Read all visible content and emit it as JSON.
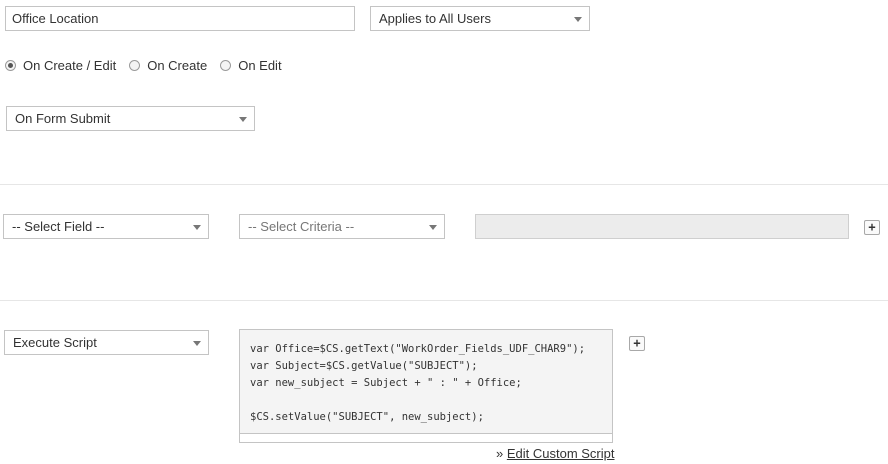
{
  "field_name": {
    "value": "Office Location"
  },
  "applies_to": {
    "selected": "Applies to All Users"
  },
  "trigger_radios": [
    {
      "label": "On Create / Edit",
      "checked": true
    },
    {
      "label": "On Create",
      "checked": false
    },
    {
      "label": "On Edit",
      "checked": false
    }
  ],
  "event_select": {
    "selected": "On Form Submit"
  },
  "criteria": {
    "field_select": "-- Select Field --",
    "criteria_select": "-- Select Criteria --",
    "add_label": "+"
  },
  "action": {
    "select": "Execute Script",
    "script": "var Office=$CS.getText(\"WorkOrder_Fields_UDF_CHAR9\");\nvar Subject=$CS.getValue(\"SUBJECT\");\nvar new_subject = Subject + \" : \" + Office;\n\n$CS.setValue(\"SUBJECT\", new_subject);",
    "add_label": "+",
    "edit_prefix": "» ",
    "edit_link": "Edit Custom Script"
  }
}
